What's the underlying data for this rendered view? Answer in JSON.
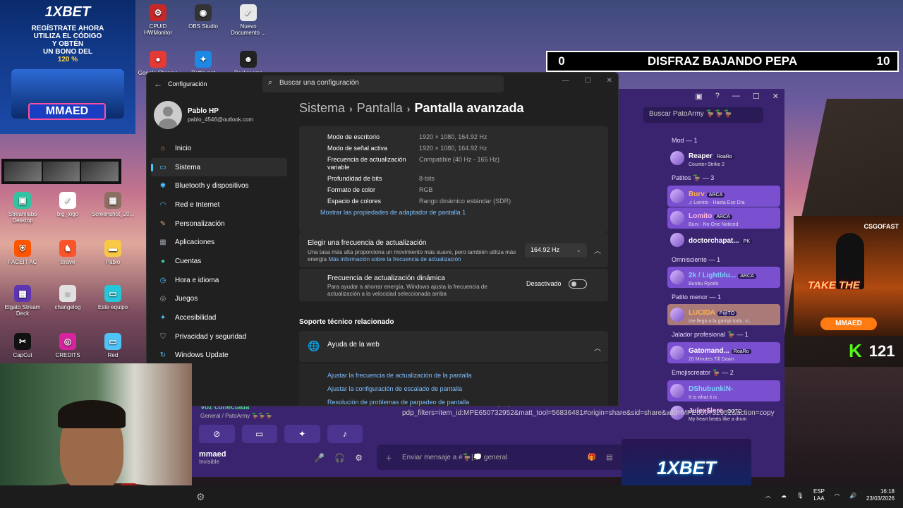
{
  "desktop": {
    "icons": [
      {
        "label": "CPUID HWMonitor",
        "icon": "cpuid-icon",
        "color": "#c62828",
        "glyph": "⚙"
      },
      {
        "label": "OBS Studio",
        "icon": "obs-icon",
        "color": "#333333",
        "glyph": "◉"
      },
      {
        "label": "Nuevo Documento ...",
        "icon": "document-icon",
        "color": "#e8e8e8",
        "glyph": "✓"
      },
      {
        "label": "Google Chrome",
        "icon": "chrome-icon",
        "color": "#e53935",
        "glyph": "●"
      },
      {
        "label": "Battle.net",
        "icon": "battlenet-icon",
        "color": "#1e88e5",
        "glyph": "✦"
      },
      {
        "label": "Backrooms",
        "icon": "backrooms-icon",
        "color": "#222222",
        "glyph": "☻"
      },
      {
        "label": "Streamlabs Desktop",
        "icon": "streamlabs-icon",
        "color": "#31c3a2",
        "glyph": "▣"
      },
      {
        "label": "big_logo",
        "icon": "image-file-icon",
        "color": "#ffffff",
        "glyph": "✓"
      },
      {
        "label": "Screenshot_20...",
        "icon": "screenshot-icon",
        "color": "#8d6e63",
        "glyph": "▦"
      },
      {
        "label": "FACEIT AC",
        "icon": "faceit-icon",
        "color": "#ff5500",
        "glyph": "⛨"
      },
      {
        "label": "Brave",
        "icon": "brave-icon",
        "color": "#fb542b",
        "glyph": "♞"
      },
      {
        "label": "Pablo",
        "icon": "folder-icon",
        "color": "#f9c846",
        "glyph": "▬"
      },
      {
        "label": "Elgato Stream Deck",
        "icon": "streamdeck-icon",
        "color": "#5e35b1",
        "glyph": "▦"
      },
      {
        "label": "changelog",
        "icon": "text-file-icon",
        "color": "#e0e0e0",
        "glyph": "≡"
      },
      {
        "label": "Este equipo",
        "icon": "computer-icon",
        "color": "#26c6da",
        "glyph": "▭"
      },
      {
        "label": "CapCut",
        "icon": "capcut-icon",
        "color": "#111111",
        "glyph": "✂"
      },
      {
        "label": "CREDITS",
        "icon": "instagram-icon",
        "color": "#d6249f",
        "glyph": "◎"
      },
      {
        "label": "Red",
        "icon": "network-icon",
        "color": "#4fc3f7",
        "glyph": "▭"
      }
    ]
  },
  "ad_top": {
    "brand": "1XBET",
    "line1": "REGÍSTRATE AHORA",
    "line2": "UTILIZA EL CÓDIGO",
    "line3": "Y OBTÉN",
    "line4": "UN BONO DEL",
    "bonus": "120 %",
    "code": "MMAED"
  },
  "scoreboard": {
    "left": "0",
    "title": "DISFRAZ BAJANDO PEPA",
    "right": "10"
  },
  "settings": {
    "app_title": "Configuración",
    "search_placeholder": "Buscar una configuración",
    "user": {
      "name": "Pablo HP",
      "email": "pablo_4546@outlook.com"
    },
    "nav": [
      {
        "label": "Inicio",
        "icon": "home-icon",
        "color": "#e8a87c",
        "glyph": "⌂",
        "active": false
      },
      {
        "label": "Sistema",
        "icon": "system-icon",
        "color": "#4cc2ff",
        "glyph": "▭",
        "active": true
      },
      {
        "label": "Bluetooth y dispositivos",
        "icon": "bluetooth-icon",
        "color": "#4cc2ff",
        "glyph": "✱",
        "active": false
      },
      {
        "label": "Red e Internet",
        "icon": "wifi-icon",
        "color": "#4cc2ff",
        "glyph": "◠",
        "active": false
      },
      {
        "label": "Personalización",
        "icon": "brush-icon",
        "color": "#f0a070",
        "glyph": "✎",
        "active": false
      },
      {
        "label": "Aplicaciones",
        "icon": "apps-icon",
        "color": "#9aa0a6",
        "glyph": "▦",
        "active": false
      },
      {
        "label": "Cuentas",
        "icon": "accounts-icon",
        "color": "#3ecf8e",
        "glyph": "●",
        "active": false
      },
      {
        "label": "Hora e idioma",
        "icon": "clock-globe-icon",
        "color": "#4cc2ff",
        "glyph": "◷",
        "active": false
      },
      {
        "label": "Juegos",
        "icon": "gamepad-icon",
        "color": "#9aa0a6",
        "glyph": "◎",
        "active": false
      },
      {
        "label": "Accesibilidad",
        "icon": "accessibility-icon",
        "color": "#4cc2ff",
        "glyph": "✦",
        "active": false
      },
      {
        "label": "Privacidad y seguridad",
        "icon": "shield-icon",
        "color": "#9aa0a6",
        "glyph": "⛉",
        "active": false
      },
      {
        "label": "Windows Update",
        "icon": "update-icon",
        "color": "#4cc2ff",
        "glyph": "↻",
        "active": false
      }
    ],
    "breadcrumb": [
      "Sistema",
      "Pantalla",
      "Pantalla avanzada"
    ],
    "display_info": [
      {
        "key": "Modo de escritorio",
        "value": "1920 × 1080, 164.92 Hz"
      },
      {
        "key": "Modo de señal activa",
        "value": "1920 × 1080, 164.92 Hz"
      },
      {
        "key": "Frecuencia de actualización variable",
        "value": "Compatible (40 Hz - 165 Hz)"
      },
      {
        "key": "Profundidad de bits",
        "value": "8-bits"
      },
      {
        "key": "Formato de color",
        "value": "RGB"
      },
      {
        "key": "Espacio de colores",
        "value": "Rango dinámico estándar (SDR)"
      }
    ],
    "adapter_link": "Mostrar las propiedades de adaptador de pantalla 1",
    "refresh": {
      "title": "Elegir una frecuencia de actualización",
      "desc": "Una tasa más alta proporciona un movimiento más suave, pero también utiliza más energía",
      "more": "Más información sobre la frecuencia de actualización",
      "value": "164.92 Hz"
    },
    "dynamic": {
      "title": "Frecuencia de actualización dinámica",
      "desc": "Para ayudar a ahorrar energía, Windows ajusta la frecuencia de actualización a la velocidad seleccionada arriba",
      "state": "Desactivado"
    },
    "support_title": "Soporte técnico relacionado",
    "help_title": "Ayuda de la web",
    "help_links": [
      "Ajustar la frecuencia de actualización de la pantalla",
      "Ajustar la configuración de escalado de pantalla",
      "Resolución de problemas de parpadeo de pantalla"
    ]
  },
  "discord": {
    "search_placeholder": "Buscar PatoArmy 🦆🦆🦆",
    "chat_preview": "https://www.mercadolibre.com.pe/p/MPE20087680?pdp_filters=item_id:MPE650732952&matt_tool=56836481#origin=share&sid=share&wid=MPE650732952&action=copy",
    "input_placeholder": "Enviar mensaje a #🦆|💭 general",
    "voice": {
      "status": "Voz conectada",
      "channel": "General / PatoArmy 🦆🦆🦆"
    },
    "user": {
      "name": "mmaed",
      "status": "Invisible"
    },
    "groups": [
      {
        "title": "Mod — 1",
        "members": [
          {
            "name": "Reaper",
            "status": "Counter-Strike 2",
            "style": "",
            "badge": "RoaRo"
          }
        ]
      },
      {
        "title": "Patitos 🦆 — 3",
        "members": [
          {
            "name": "Burv",
            "status": "♫ Lomito · Hasta Ese Día",
            "style": "hl o",
            "badge": "ARCA"
          },
          {
            "name": "Lomito",
            "status": "Burv - No One Noticed",
            "style": "hl pk",
            "badge": "ARCA"
          },
          {
            "name": "doctorchapat...",
            "status": "",
            "style": "",
            "badge": "PK"
          }
        ]
      },
      {
        "title": "Omnisciente — 1",
        "members": [
          {
            "name": "2k / Lightblu...",
            "status": "Bunbu Ryodo",
            "style": "hl b",
            "badge": "ARCA"
          }
        ]
      },
      {
        "title": "Patito menor — 1",
        "members": [
          {
            "name": "LUCIDA",
            "status": "me llego a la gampi todo, si...",
            "style": "hl2 o",
            "badge": "P@TO"
          }
        ]
      },
      {
        "title": "Jalador profesional 🦆 — 1",
        "members": [
          {
            "name": "Gatomand...",
            "status": "20 Minutes Till Dawn",
            "style": "hl",
            "badge": "RoaRo"
          }
        ]
      },
      {
        "title": "Emojiscreator 🦆 — 2",
        "members": [
          {
            "name": "DShubunkiN-",
            "status": "It is what it is",
            "style": "hl b",
            "badge": ""
          },
          {
            "name": "Julex$lere",
            "status": "My heart beats like a drum",
            "style": "pk",
            "badge": "GOTO"
          }
        ]
      }
    ]
  },
  "overlay": {
    "brand": "CSGOFAST",
    "promo": "TAKE THE",
    "code": "MMAED",
    "kick_followers": "121"
  },
  "ad_bottom": {
    "brand": "1XBET"
  },
  "taskbar": {
    "lang_line1": "ESP",
    "lang_line2": "LAA",
    "time": "16:18",
    "date": "23/03/2026"
  }
}
